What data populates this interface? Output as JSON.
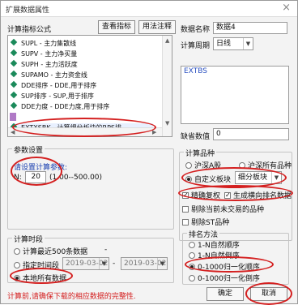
{
  "window": {
    "title": "扩展数据属性",
    "close_glyph": "×"
  },
  "formula": {
    "label": "计算指标公式",
    "view_button": "查看指标",
    "usage_button": "用法注释",
    "items": [
      "SUPL - 主力集散线",
      "SUPV - 主力净买量",
      "SUPH - 主力活跃度",
      "SUPAMO - 主力资金线",
      "DDE排序 - DDE,用于排序",
      "SUP排序 - SUP,用于排序",
      "DDE力度 - DDE力度,用于排序",
      "EXTXSBK - 计算细分板块的RPS排"
    ]
  },
  "data_name": {
    "label": "数据名称",
    "value": "数据4"
  },
  "period": {
    "label": "计算周期",
    "value": "日线"
  },
  "code_box": {
    "value": "EXTBS"
  },
  "missing": {
    "label": "缺省数值",
    "value": "0"
  },
  "params": {
    "title": "参数设置",
    "hint": "请设置计算参数:",
    "n_label": "N:",
    "n_value": "20",
    "n_range": "(1.00--500.00)"
  },
  "category": {
    "title": "计算品种",
    "opt_hs": "沪深A股",
    "opt_all": "沪深所有品种",
    "opt_custom": "自定义板块",
    "custom_value": "细分板块",
    "precise": "精确复权",
    "generate_rank": "生成横向排名数据",
    "exclude_suspended": "剔除当前未交易的品种",
    "exclude_st": "剔除ST品种"
  },
  "rank": {
    "title": "排名方法",
    "opt1": "1-N自然顺序",
    "opt2": "1-N自然倒序",
    "opt3": "0-1000归一化顺序",
    "opt4": "0-1000归一化倒序"
  },
  "timeframe": {
    "title": "计算时段",
    "recent": "计算最近500条数据",
    "dash": "-",
    "specified": "指定时间段",
    "date_from": "2019-03-02",
    "date_to": "2019-03-02",
    "range_dash": "-",
    "local_all": "本地所有数据"
  },
  "footer": {
    "note": "计算前,请确保下载的相应数据的完整性.",
    "ok": "确定",
    "cancel": "取消"
  },
  "colors": {
    "annotation": "#d42020",
    "hint": "#1a3fb0"
  }
}
